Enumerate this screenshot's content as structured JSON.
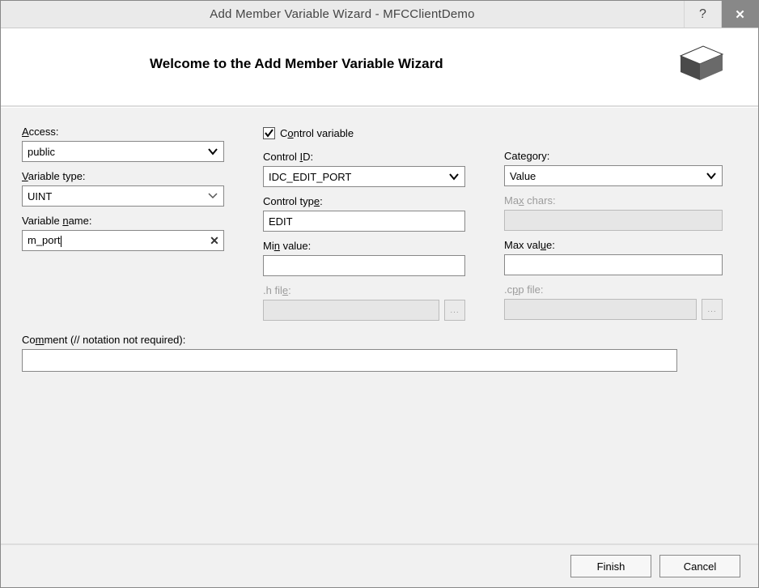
{
  "titlebar": {
    "title": "Add Member Variable Wizard - MFCClientDemo",
    "help_label": "?",
    "close_label": "✕"
  },
  "header": {
    "title": "Welcome to the Add Member Variable Wizard"
  },
  "left": {
    "access_label": "Access:",
    "access_value": "public",
    "vartype_label": "Variable type:",
    "vartype_value": "UINT",
    "varname_label": "Variable name:",
    "varname_value": "m_port"
  },
  "mid": {
    "control_variable_label": "Control variable",
    "control_variable_checked": true,
    "control_id_label": "Control ID:",
    "control_id_value": "IDC_EDIT_PORT",
    "control_type_label": "Control type:",
    "control_type_value": "EDIT",
    "min_value_label": "Min value:",
    "min_value": "",
    "hfile_label": ".h file:",
    "hfile_value": ""
  },
  "right": {
    "category_label": "Category:",
    "category_value": "Value",
    "max_chars_label": "Max chars:",
    "max_chars_value": "",
    "max_value_label": "Max value:",
    "max_value": "",
    "cppfile_label": ".cpp file:",
    "cppfile_value": ""
  },
  "comment": {
    "label": "Comment (// notation not required):",
    "value": ""
  },
  "footer": {
    "finish": "Finish",
    "cancel": "Cancel"
  }
}
